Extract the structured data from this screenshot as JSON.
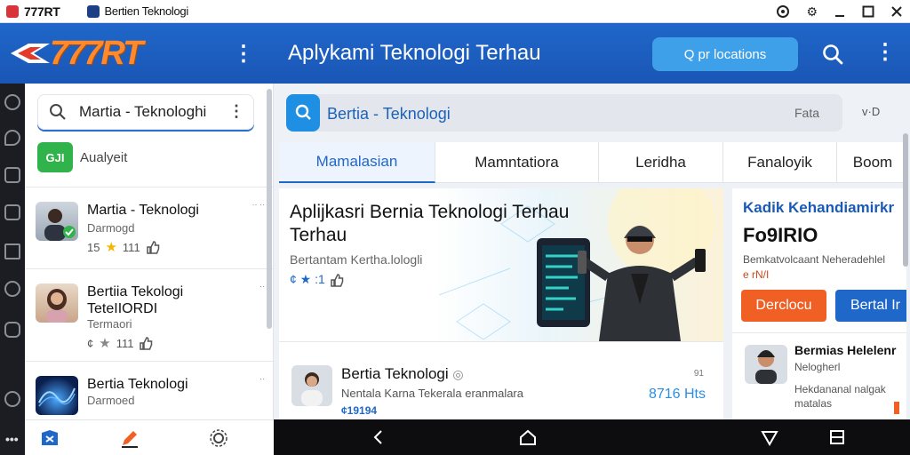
{
  "titlebar": {
    "app_name": "777RT",
    "tab_title": "Bertien Teknologi"
  },
  "header": {
    "logo_text": "777RT",
    "title": "Aplykami Teknologi Terhau",
    "search_button": "Q pr locations"
  },
  "sidebar": {
    "search_text": "Martia - Teknologhi",
    "badge_icon_text": "GJI",
    "badge_label": "Aualyeit",
    "items": [
      {
        "title": "Martia - Teknologi",
        "sub": "Darmogd",
        "rating": "15",
        "count": "111",
        "corner": "·· ··"
      },
      {
        "title": "Bertiia Tekologi TeteIIORDI",
        "sub": "Termaori",
        "rating": "¢",
        "count": "111",
        "corner": "··"
      },
      {
        "title": "Bertia  Teknologi",
        "sub": "Darmoed",
        "rating": "",
        "count": "",
        "corner": "··"
      }
    ]
  },
  "main_search": {
    "text": "Bertia - Teknologi",
    "right_text": "Fata",
    "extra": "v·D"
  },
  "tabs": [
    {
      "label": "Mamalasian"
    },
    {
      "label": "Mamntatiora"
    },
    {
      "label": "Leridha"
    },
    {
      "label": "Fanaloyik"
    },
    {
      "label": "Boom"
    }
  ],
  "featured": {
    "title": "Aplijkasri Bernia Teknologi Terhau Terhau",
    "subtitle": "Bertantam Kertha.lologli",
    "meta": "¢ ★ :1",
    "row": {
      "title": "Bertia Teknologi",
      "sub": "Nentala Karna Tekerala eranmalara",
      "meta": "¢19194",
      "corner": "91",
      "price": "8716 Hts"
    }
  },
  "side_card": {
    "title": "Kadik Kehandiamirkr",
    "code": "Fo9IRIO",
    "desc": "Bemkatvolcaant Neheradehlel",
    "badge": "e rN/I",
    "btn_primary": "Derclocu",
    "btn_secondary": "Bertal Ir",
    "item_title": "Bermias Helelenr",
    "item_sub": "Nelogherl",
    "item_desc": "Hekdananal nalgak matalas"
  },
  "colors": {
    "header_blue": "#1f67c9",
    "accent_orange": "#f06025",
    "logo_orange": "#ff8a2b"
  }
}
